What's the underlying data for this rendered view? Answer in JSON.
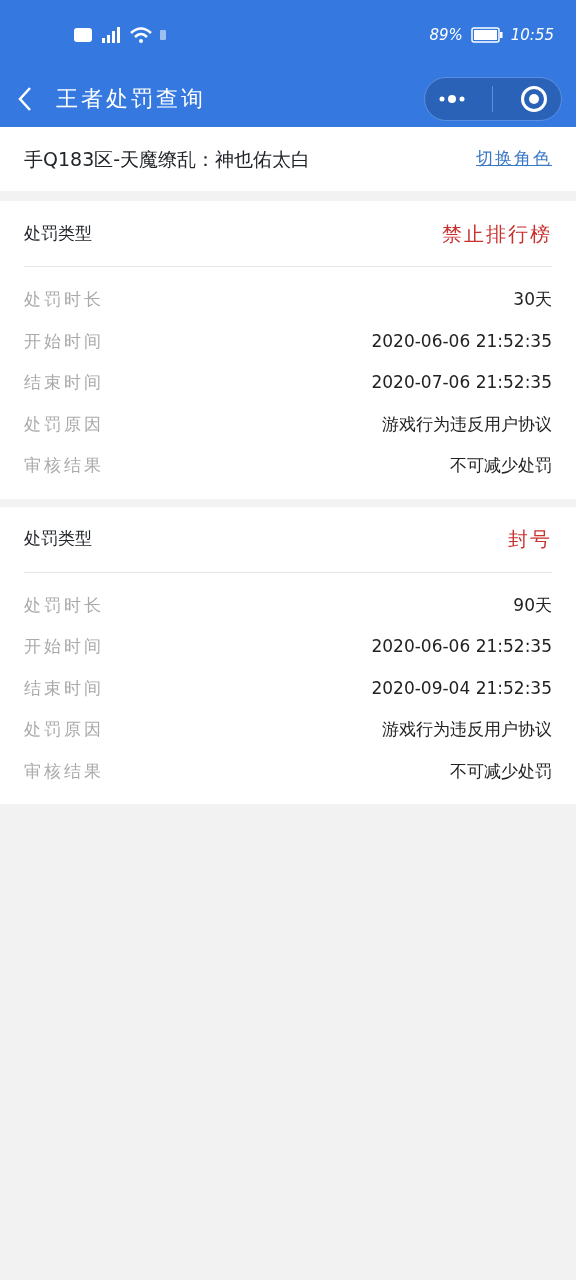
{
  "status_bar": {
    "battery_text": "89%",
    "time": "10:55"
  },
  "nav": {
    "title": "王者处罚查询"
  },
  "account": {
    "role": "手Q183区-天魔缭乱：神也佑太白",
    "switch_link": "切换角色"
  },
  "penalties": [
    {
      "type_label": "处罚类型",
      "type_value": "禁止排行榜",
      "rows": [
        {
          "label": "处罚时长",
          "value": "30天"
        },
        {
          "label": "开始时间",
          "value": "2020-06-06 21:52:35"
        },
        {
          "label": "结束时间",
          "value": "2020-07-06 21:52:35"
        },
        {
          "label": "处罚原因",
          "value": "游戏行为违反用户协议"
        },
        {
          "label": "审核结果",
          "value": "不可减少处罚"
        }
      ]
    },
    {
      "type_label": "处罚类型",
      "type_value": "封号",
      "rows": [
        {
          "label": "处罚时长",
          "value": "90天"
        },
        {
          "label": "开始时间",
          "value": "2020-06-06 21:52:35"
        },
        {
          "label": "结束时间",
          "value": "2020-09-04 21:52:35"
        },
        {
          "label": "处罚原因",
          "value": "游戏行为违反用户协议"
        },
        {
          "label": "审核结果",
          "value": "不可减少处罚"
        }
      ]
    }
  ]
}
